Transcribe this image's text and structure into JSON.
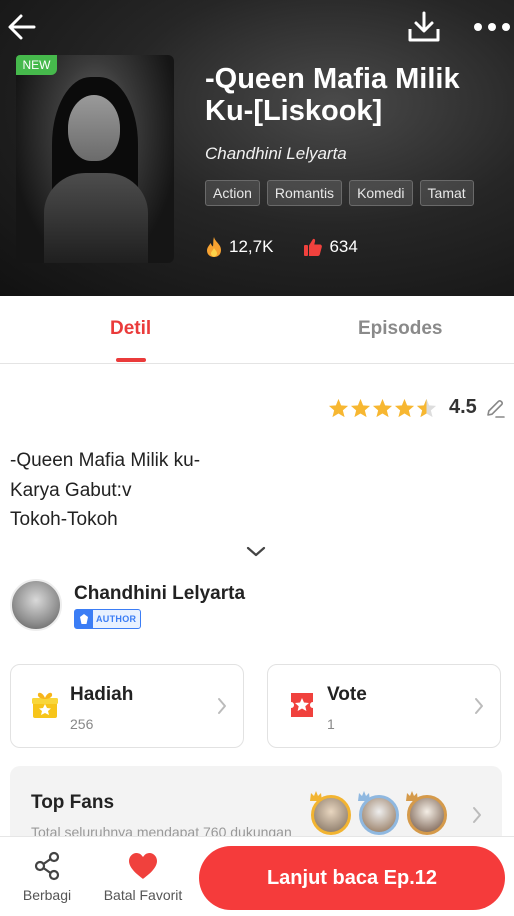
{
  "header": {
    "back_icon": "arrow-left-icon",
    "download_icon": "download-icon",
    "more_icon": "more-dots-icon"
  },
  "book": {
    "badge": "NEW",
    "title": "-Queen Mafia Milik Ku-[Liskook]",
    "author": "Chandhini Lelyarta",
    "tags": [
      "Action",
      "Romantis",
      "Komedi",
      "Tamat"
    ],
    "views": "12,7K",
    "likes": "634"
  },
  "tabs": [
    {
      "label": "Detil",
      "active": true
    },
    {
      "label": "Episodes",
      "active": false
    }
  ],
  "rating": {
    "value": "4.5",
    "stars": 4.5
  },
  "synopsis": {
    "lines": [
      "-Queen Mafia Milik ku-",
      "Karya Gabut:v",
      "Tokoh-Tokoh"
    ]
  },
  "author_section": {
    "name": "Chandhini Lelyarta",
    "badge": "AUTHOR"
  },
  "cards": {
    "hadiah": {
      "label": "Hadiah",
      "count": "256"
    },
    "vote": {
      "label": "Vote",
      "count": "1"
    }
  },
  "top_fans": {
    "title": "Top Fans",
    "subtitle": "Total seluruhnya mendapat 760 dukungan"
  },
  "bottom_bar": {
    "share_label": "Berbagi",
    "favorite_label": "Batal Favorit",
    "read_label": "Lanjut baca Ep.12"
  },
  "colors": {
    "accent": "#f53b3b",
    "tab_active": "#ea3b3b",
    "star": "#f7b731",
    "badge_new": "#46b94c",
    "author_badge": "#3b7df5"
  }
}
